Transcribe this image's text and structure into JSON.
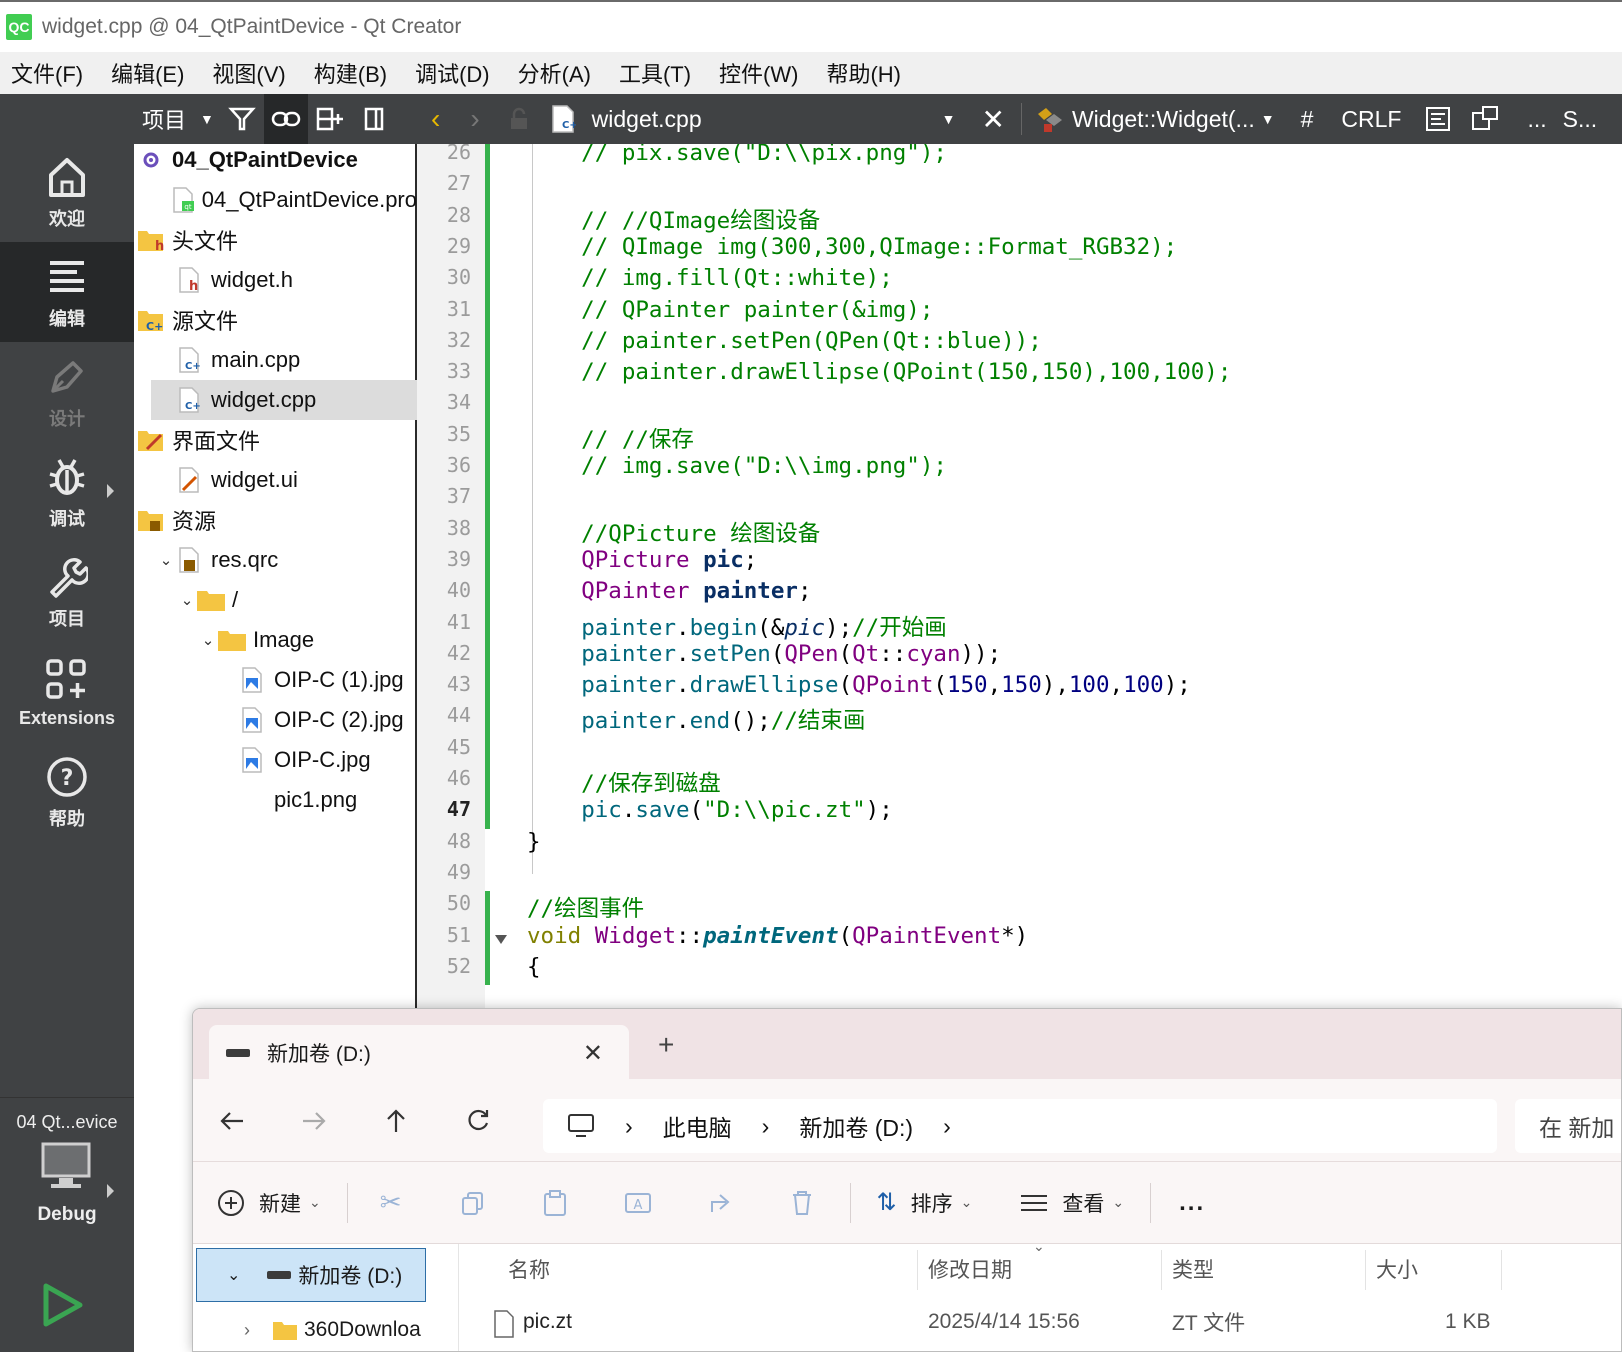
{
  "window": {
    "title": "widget.cpp @ 04_QtPaintDevice - Qt Creator",
    "logo_text": "QC"
  },
  "menu": [
    "文件(F)",
    "编辑(E)",
    "视图(V)",
    "构建(B)",
    "调试(D)",
    "分析(A)",
    "工具(T)",
    "控件(W)",
    "帮助(H)"
  ],
  "modes": [
    {
      "label": "欢迎",
      "icon": "home-icon",
      "state": "normal"
    },
    {
      "label": "编辑",
      "icon": "edit-lines-icon",
      "state": "active"
    },
    {
      "label": "设计",
      "icon": "design-pen-icon",
      "state": "disabled"
    },
    {
      "label": "调试",
      "icon": "bug-icon",
      "state": "normal"
    },
    {
      "label": "项目",
      "icon": "wrench-icon",
      "state": "normal"
    },
    {
      "label": "Extensions",
      "icon": "extensions-icon",
      "state": "normal"
    },
    {
      "label": "帮助",
      "icon": "help-icon",
      "state": "normal"
    }
  ],
  "project_selector": "04 Qt...evice",
  "build_config": "Debug",
  "nav_toolbar": {
    "view_label": "项目"
  },
  "editor_toolbar": {
    "file_name": "widget.cpp",
    "symbol": "Widget::Widget(...",
    "hash": "#",
    "line_ending": "CRLF",
    "more": "...",
    "trailing": "S..."
  },
  "project_tree": [
    {
      "label": "04_QtPaintDevice",
      "indent": 0,
      "icon": "project-icon",
      "bold": true
    },
    {
      "label": "04_QtPaintDevice.pro",
      "indent": 1,
      "icon": "pro-file-icon"
    },
    {
      "label": "头文件",
      "indent": 0,
      "icon": "header-folder-icon"
    },
    {
      "label": "widget.h",
      "indent": 1,
      "icon": "header-file-icon"
    },
    {
      "label": "源文件",
      "indent": 0,
      "icon": "source-folder-icon"
    },
    {
      "label": "main.cpp",
      "indent": 1,
      "icon": "cpp-file-icon"
    },
    {
      "label": "widget.cpp",
      "indent": 1,
      "icon": "cpp-file-icon",
      "selected": true
    },
    {
      "label": "界面文件",
      "indent": 0,
      "icon": "forms-folder-icon"
    },
    {
      "label": "widget.ui",
      "indent": 1,
      "icon": "ui-file-icon"
    },
    {
      "label": "资源",
      "indent": 0,
      "icon": "resource-folder-icon"
    },
    {
      "label": "res.qrc",
      "indent": 1,
      "icon": "qrc-file-icon",
      "twisty": "v"
    },
    {
      "label": "/",
      "indent": 2,
      "icon": "folder-icon",
      "twisty": "v"
    },
    {
      "label": "Image",
      "indent": 3,
      "icon": "folder-icon",
      "twisty": "v"
    },
    {
      "label": "OIP-C (1).jpg",
      "indent": 4,
      "icon": "image-file-icon"
    },
    {
      "label": "OIP-C (2).jpg",
      "indent": 4,
      "icon": "image-file-icon"
    },
    {
      "label": "OIP-C.jpg",
      "indent": 4,
      "icon": "image-file-icon"
    },
    {
      "label": "pic1.png",
      "indent": 4,
      "icon": ""
    }
  ],
  "code": {
    "current_line": 47,
    "lines": [
      {
        "n": 26,
        "seg": [
          [
            "com",
            "    // pix.save(\"D:\\\\pix.png\");"
          ]
        ]
      },
      {
        "n": 27,
        "seg": []
      },
      {
        "n": 28,
        "seg": [
          [
            "com",
            "    // //QImage绘图设备"
          ]
        ]
      },
      {
        "n": 29,
        "seg": [
          [
            "com",
            "    // QImage img(300,300,QImage::Format_RGB32);"
          ]
        ]
      },
      {
        "n": 30,
        "seg": [
          [
            "com",
            "    // img.fill(Qt::white);"
          ]
        ]
      },
      {
        "n": 31,
        "seg": [
          [
            "com",
            "    // QPainter painter(&img);"
          ]
        ]
      },
      {
        "n": 32,
        "seg": [
          [
            "com",
            "    // painter.setPen(QPen(Qt::blue));"
          ]
        ]
      },
      {
        "n": 33,
        "seg": [
          [
            "com",
            "    // painter.drawEllipse(QPoint(150,150),100,100);"
          ]
        ]
      },
      {
        "n": 34,
        "seg": []
      },
      {
        "n": 35,
        "seg": [
          [
            "com",
            "    // //保存"
          ]
        ]
      },
      {
        "n": 36,
        "seg": [
          [
            "com",
            "    // img.save(\"D:\\\\img.png\");"
          ]
        ]
      },
      {
        "n": 37,
        "seg": []
      },
      {
        "n": 38,
        "seg": [
          [
            "com",
            "    //QPicture 绘图设备"
          ]
        ]
      },
      {
        "n": 39,
        "seg": [
          [
            "plain",
            "    "
          ],
          [
            "type",
            "QPicture"
          ],
          [
            "plain",
            " "
          ],
          [
            "var",
            "pic"
          ],
          [
            "plain",
            ";"
          ]
        ]
      },
      {
        "n": 40,
        "seg": [
          [
            "plain",
            "    "
          ],
          [
            "type",
            "QPainter"
          ],
          [
            "plain",
            " "
          ],
          [
            "var",
            "painter"
          ],
          [
            "plain",
            ";"
          ]
        ]
      },
      {
        "n": 41,
        "seg": [
          [
            "plain",
            "    "
          ],
          [
            "var2",
            "painter"
          ],
          [
            "plain",
            "."
          ],
          [
            "fn",
            "begin"
          ],
          [
            "plain",
            "(&"
          ],
          [
            "param",
            "pic"
          ],
          [
            "plain",
            ");"
          ],
          [
            "com",
            "//开始画"
          ]
        ]
      },
      {
        "n": 42,
        "seg": [
          [
            "plain",
            "    "
          ],
          [
            "var2",
            "painter"
          ],
          [
            "plain",
            "."
          ],
          [
            "fn",
            "setPen"
          ],
          [
            "plain",
            "("
          ],
          [
            "type",
            "QPen"
          ],
          [
            "plain",
            "("
          ],
          [
            "type",
            "Qt"
          ],
          [
            "plain",
            "::"
          ],
          [
            "type",
            "cyan"
          ],
          [
            "plain",
            "));"
          ]
        ]
      },
      {
        "n": 43,
        "seg": [
          [
            "plain",
            "    "
          ],
          [
            "var2",
            "painter"
          ],
          [
            "plain",
            "."
          ],
          [
            "fn",
            "drawEllipse"
          ],
          [
            "plain",
            "("
          ],
          [
            "type",
            "QPoint"
          ],
          [
            "plain",
            "("
          ],
          [
            "num",
            "150"
          ],
          [
            "plain",
            ","
          ],
          [
            "num",
            "150"
          ],
          [
            "plain",
            "),"
          ],
          [
            "num",
            "100"
          ],
          [
            "plain",
            ","
          ],
          [
            "num",
            "100"
          ],
          [
            "plain",
            ");"
          ]
        ]
      },
      {
        "n": 44,
        "seg": [
          [
            "plain",
            "    "
          ],
          [
            "var2",
            "painter"
          ],
          [
            "plain",
            "."
          ],
          [
            "fn",
            "end"
          ],
          [
            "plain",
            "();"
          ],
          [
            "com",
            "//结束画"
          ]
        ]
      },
      {
        "n": 45,
        "seg": []
      },
      {
        "n": 46,
        "seg": [
          [
            "com",
            "    //保存到磁盘"
          ]
        ]
      },
      {
        "n": 47,
        "seg": [
          [
            "plain",
            "    "
          ],
          [
            "var2",
            "pic"
          ],
          [
            "plain",
            "."
          ],
          [
            "fn",
            "save"
          ],
          [
            "plain",
            "("
          ],
          [
            "str",
            "\"D:\\\\pic.zt\""
          ],
          [
            "plain",
            ");"
          ]
        ]
      },
      {
        "n": 48,
        "seg": [
          [
            "plain",
            "}"
          ]
        ]
      },
      {
        "n": 49,
        "seg": []
      },
      {
        "n": 50,
        "seg": [
          [
            "com",
            "//绘图事件"
          ]
        ]
      },
      {
        "n": 51,
        "seg": [
          [
            "kw",
            "void"
          ],
          [
            "plain",
            " "
          ],
          [
            "type",
            "Widget"
          ],
          [
            "plain",
            "::"
          ],
          [
            "fi",
            "paintEvent"
          ],
          [
            "plain",
            "("
          ],
          [
            "type",
            "QPaintEvent"
          ],
          [
            "plain",
            "*)"
          ]
        ]
      },
      {
        "n": 52,
        "seg": [
          [
            "plain",
            "{"
          ]
        ]
      }
    ]
  },
  "explorer": {
    "tab_title": "新加卷 (D:)",
    "breadcrumb": [
      "此电脑",
      "新加卷 (D:)"
    ],
    "search_placeholder": "在 新加",
    "commands": {
      "new": "新建",
      "sort": "排序",
      "view": "查看",
      "more": "..."
    },
    "nav_pane": {
      "selected": "新加卷 (D:)",
      "next": "360Downloa"
    },
    "columns": [
      "名称",
      "修改日期",
      "类型",
      "大小"
    ],
    "rows": [
      {
        "name": "pic.zt",
        "modified": "2025/4/14 15:56",
        "type": "ZT 文件",
        "size": "1 KB"
      }
    ]
  },
  "colors": {
    "mode_bar": "#404244",
    "mode_active": "#262829",
    "change_marker": "#37b24d",
    "selection": "#cce4f7",
    "run_arrow": "#3aa552"
  }
}
